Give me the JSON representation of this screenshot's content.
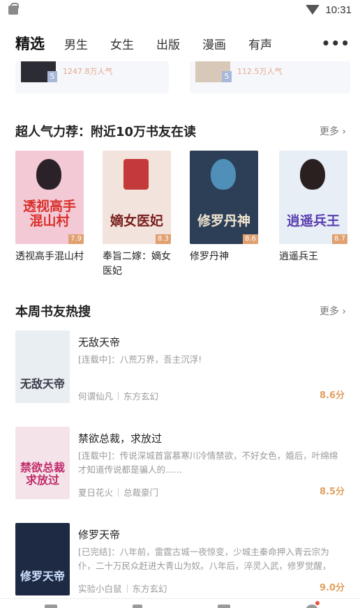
{
  "status_bar": {
    "time": "10:31"
  },
  "tabs": [
    {
      "label": "精选",
      "active": true
    },
    {
      "label": "男生"
    },
    {
      "label": "女生"
    },
    {
      "label": "出版"
    },
    {
      "label": "漫画"
    },
    {
      "label": "有声"
    }
  ],
  "peek_row": [
    {
      "score": "5",
      "popularity": "1247.8万人气"
    },
    {
      "score": "5",
      "popularity": "112.5万人气"
    }
  ],
  "recommend_section": {
    "title": "超人气力荐：附近10万书友在读",
    "more_label": "更多 ›",
    "books": [
      {
        "title": "透视高手混山村",
        "score": "7.9",
        "cover_text": "透视高手混山村",
        "cover_bg": "#f3c9d6",
        "cover_fg": "#d9302a"
      },
      {
        "title": "奉旨二嫁：嫡女医妃",
        "score": "8.3",
        "cover_text": "嫡女医妃",
        "cover_bg": "#f2e4dc",
        "cover_fg": "#7a1f1f"
      },
      {
        "title": "修罗丹神",
        "score": "8.6",
        "cover_text": "修罗丹神",
        "cover_bg": "#2d3f57",
        "cover_fg": "#f0e6d0"
      },
      {
        "title": "逍遥兵王",
        "score": "8.7",
        "cover_text": "逍遥兵王",
        "cover_bg": "#e8eef6",
        "cover_fg": "#5a3fb0"
      }
    ]
  },
  "weekly_section": {
    "title": "本周书友热搜",
    "more_label": "更多 ›",
    "books": [
      {
        "title": "无敌天帝",
        "desc": "[连载中]：八荒万界，吾主沉浮!",
        "author": "何谓仙凡",
        "genre": "东方玄幻",
        "score": "8.6分",
        "cover_text": "无敌天帝",
        "cover_bg": "#e9eef2",
        "cover_fg": "#3a3a48"
      },
      {
        "title": "禁欲总裁，求放过",
        "desc": "[连载中]：传说深城首富慕寒川冷情禁欲，不好女色，婚后，叶绵绵才知道传说都是骗人的......",
        "author": "夏日花火",
        "genre": "总裁豪门",
        "score": "8.5分",
        "cover_text": "禁欲总裁求放过",
        "cover_bg": "#f4e4ea",
        "cover_fg": "#c02a6a"
      },
      {
        "title": "修罗天帝",
        "desc": "[已完结]：八年前，雷霆古城一夜惊变，少城主秦命押入青云宗为仆，二十万民众赶进大青山为奴。八年后，淬灵入武，修罗觉醒，不...",
        "author": "实验小白鼠",
        "genre": "东方玄幻",
        "score": "9.0分",
        "cover_text": "修罗天帝",
        "cover_bg": "#1e2a44",
        "cover_fg": "#cfe0ff"
      }
    ]
  }
}
